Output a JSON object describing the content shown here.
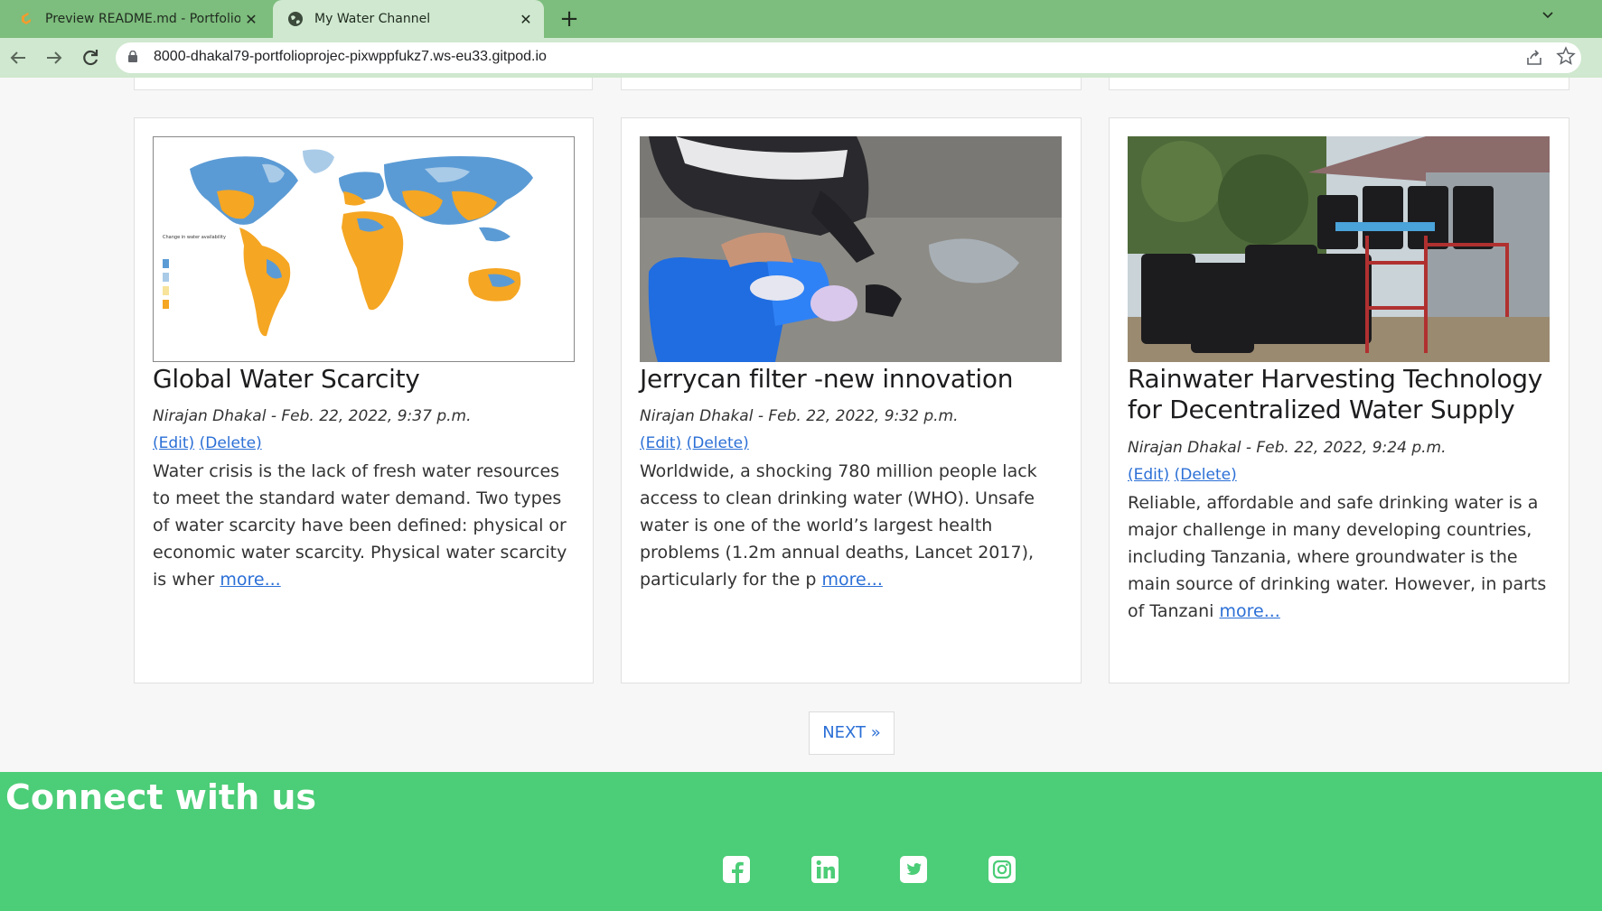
{
  "browser": {
    "tabs": [
      {
        "title": "Preview README.md - Portfolio-p",
        "active": false,
        "favicon": "gitpod-icon"
      },
      {
        "title": "My Water Channel",
        "active": true,
        "favicon": "globe-icon"
      }
    ],
    "close_glyph": "✕",
    "new_tab_glyph": "+",
    "url": "8000-dhakal79-portfolioprojec-pixwppfukz7.ws-eu33.gitpod.io"
  },
  "posts": [
    {
      "title": "Global Water Scarcity",
      "author": "Nirajan Dhakal",
      "date": "Feb. 22, 2022, 9:37 p.m.",
      "edit_label": "(Edit)",
      "delete_label": "(Delete)",
      "excerpt": "Water crisis is the lack of fresh water resources to meet the standard water demand. Two types of water scarcity have been defined: physical or economic water scarcity. Physical water scarcity is wher",
      "more_label": "more...",
      "image": "world-water-map-image"
    },
    {
      "title": "Jerrycan filter -new innovation",
      "author": "Nirajan Dhakal",
      "date": "Feb. 22, 2022, 9:32 p.m.",
      "edit_label": "(Edit)",
      "delete_label": "(Delete)",
      "excerpt": "Worldwide, a shocking 780 million people lack access to clean drinking water (WHO). Unsafe water is one of the world’s largest health problems (1.2m annual deaths, Lancet 2017), particularly for the p",
      "more_label": "more...",
      "image": "jerrycan-photo-image"
    },
    {
      "title": "Rainwater Harvesting Technology for Decentralized Water Supply",
      "author": "Nirajan Dhakal",
      "date": "Feb. 22, 2022, 9:24 p.m.",
      "edit_label": "(Edit)",
      "delete_label": "(Delete)",
      "excerpt": "Reliable, affordable and safe drinking water is a major challenge in many developing countries, including Tanzania, where groundwater is the main source of drinking water. However, in parts of Tanzani",
      "more_label": "more...",
      "image": "rainwater-tanks-photo-image"
    }
  ],
  "pagination": {
    "next_label": "NEXT »"
  },
  "footer": {
    "title": "Connect with us",
    "social": [
      "facebook-icon",
      "linkedin-icon",
      "twitter-icon",
      "instagram-icon"
    ]
  },
  "colors": {
    "tabbar": "#7dbd7d",
    "footer": "#4ccd77",
    "link": "#2b6fd6"
  }
}
